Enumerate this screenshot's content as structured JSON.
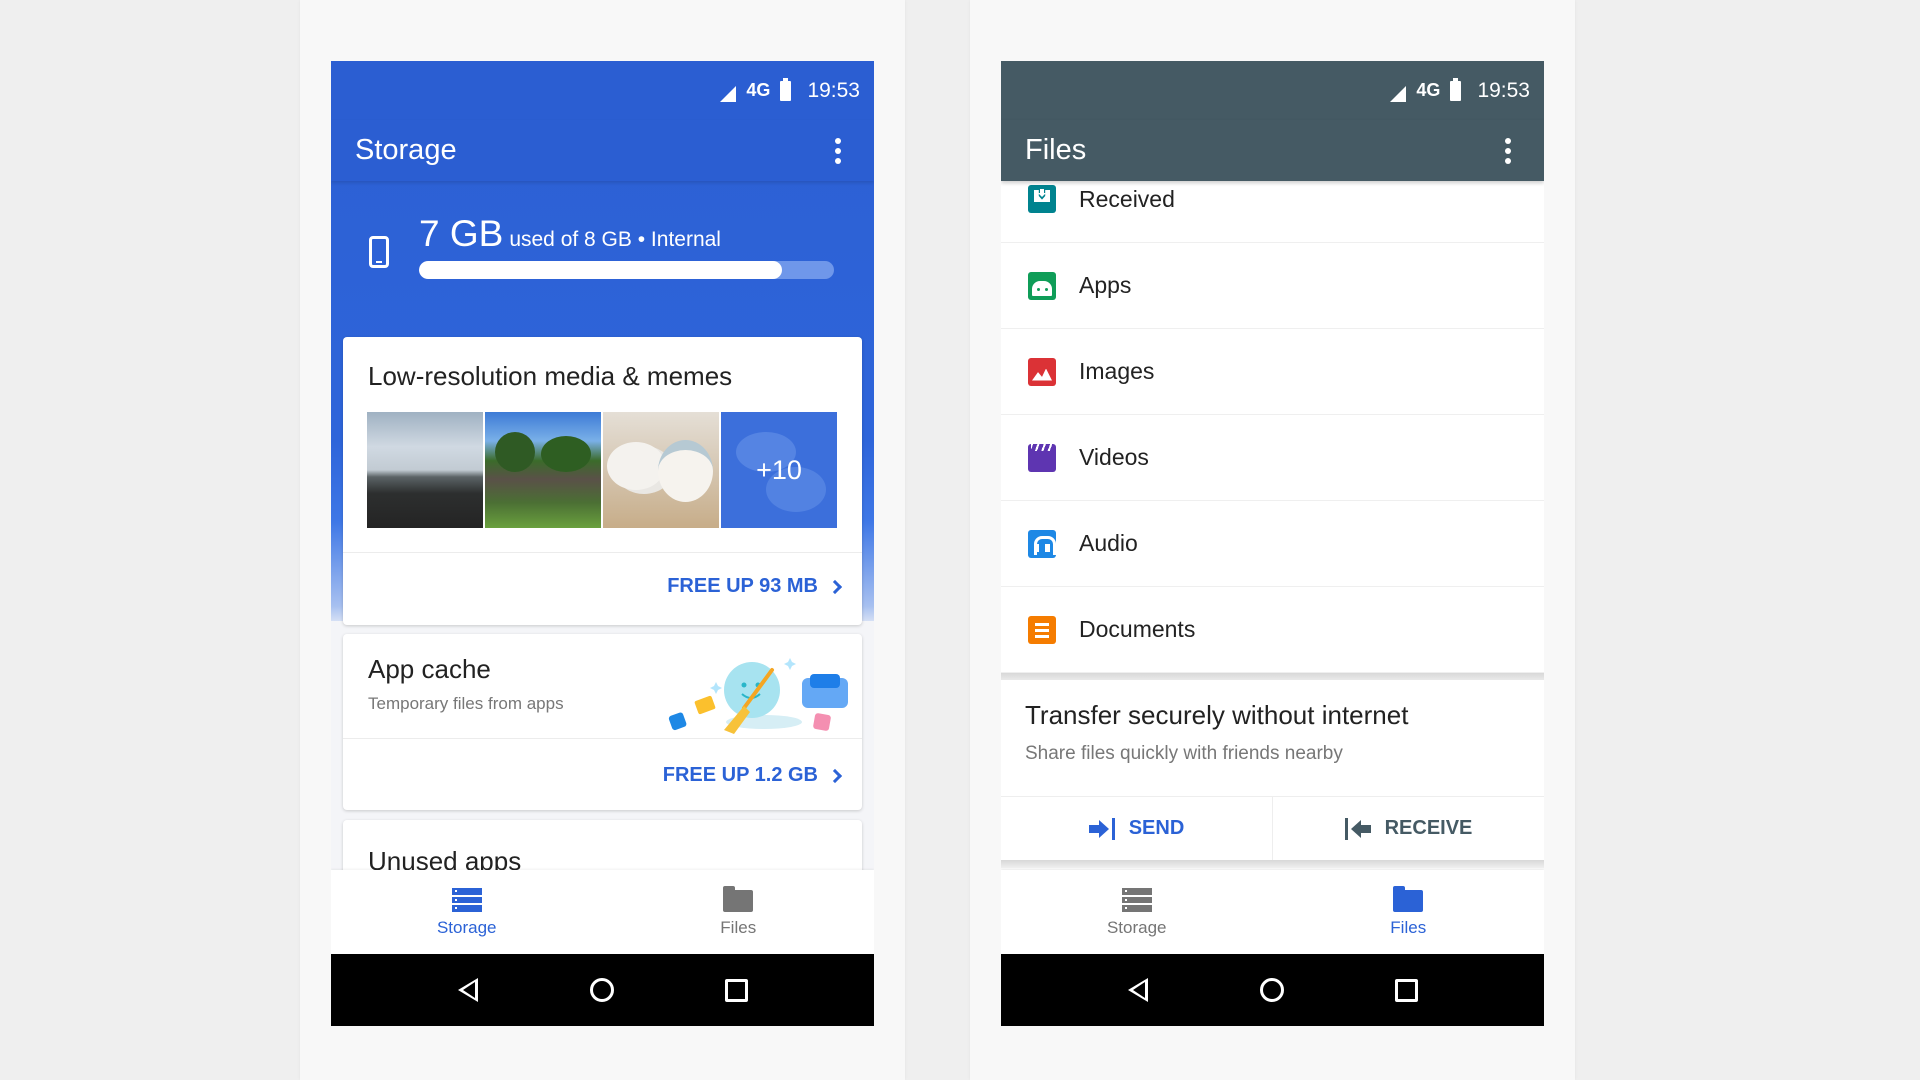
{
  "status_bar": {
    "signal_icon": "cell-signal-icon",
    "network": "4G",
    "battery_icon": "battery-icon",
    "time": "19:53"
  },
  "storage_screen": {
    "title": "Storage",
    "menu_icon": "more-vert-icon",
    "accent_color": "#2b5ed2",
    "summary": {
      "device_icon": "phone-icon",
      "used": "7 GB",
      "detail": "used of 8 GB • Internal",
      "used_fraction": 0.875
    },
    "cards": [
      {
        "title": "Low-resolution media & memes",
        "thumbnails": [
          "beach-photo",
          "park-crowd-photo",
          "cats-photo",
          "meringue-photo"
        ],
        "more_count": "+10",
        "action": "FREE UP 93 MB"
      },
      {
        "title": "App cache",
        "subtitle": "Temporary files from apps",
        "illustration": "cleaning-broom-illustration",
        "action": "FREE UP 1.2 GB"
      },
      {
        "title": "Unused apps"
      }
    ],
    "bottom_nav": [
      {
        "label": "Storage",
        "icon": "storage-icon",
        "active": true
      },
      {
        "label": "Files",
        "icon": "folder-icon",
        "active": false
      }
    ]
  },
  "files_screen": {
    "title": "Files",
    "menu_icon": "more-vert-icon",
    "accent_color": "#455a64",
    "categories": [
      {
        "label": "Received",
        "icon": "received-icon",
        "color": "#00838f"
      },
      {
        "label": "Apps",
        "icon": "android-icon",
        "color": "#0f9d58"
      },
      {
        "label": "Images",
        "icon": "image-icon",
        "color": "#db3236"
      },
      {
        "label": "Videos",
        "icon": "video-icon",
        "color": "#5e35b1"
      },
      {
        "label": "Audio",
        "icon": "headphones-icon",
        "color": "#1e88e5"
      },
      {
        "label": "Documents",
        "icon": "document-icon",
        "color": "#f57c00"
      }
    ],
    "transfer": {
      "title": "Transfer securely without internet",
      "subtitle": "Share files quickly with friends nearby",
      "send": "SEND",
      "receive": "RECEIVE"
    },
    "bottom_nav": [
      {
        "label": "Storage",
        "icon": "storage-icon",
        "active": false
      },
      {
        "label": "Files",
        "icon": "folder-icon",
        "active": true
      }
    ]
  },
  "system_nav": {
    "back": "back-icon",
    "home": "home-icon",
    "recents": "recents-icon"
  }
}
